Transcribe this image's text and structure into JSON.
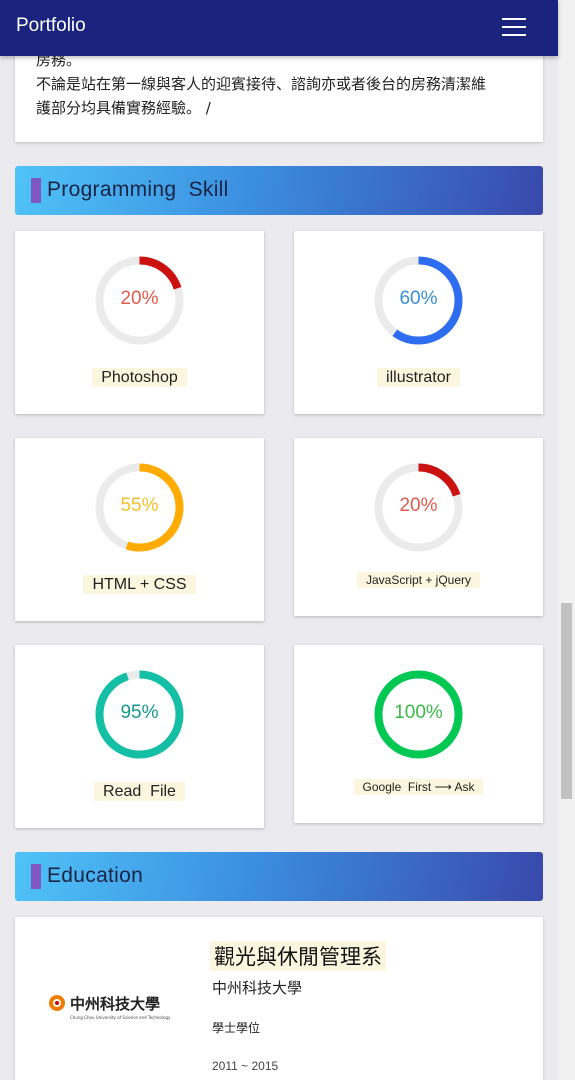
{
  "nav": {
    "brand": "Portfolio",
    "menu_icon": "hamburger-menu-icon",
    "background": "#1a237e"
  },
  "about": {
    "lines": [
      "房務。",
      "不論是站在第一線與客人的迎賓接待、諮詢亦或者後台的房務清潔維",
      "護部分均具備實務經驗。 /"
    ]
  },
  "sections": {
    "programming": "Programming  Skill",
    "education": "Education"
  },
  "skills": [
    {
      "label": "Photoshop",
      "percent": 20,
      "percent_text": "20%",
      "color": "#cc1111",
      "text_color": "#e05a4e"
    },
    {
      "label": "illustrator",
      "percent": 60,
      "percent_text": "60%",
      "color": "#2f6df0",
      "text_color": "#3a8fd8"
    },
    {
      "label": "HTML + CSS",
      "percent": 55,
      "percent_text": "55%",
      "color": "#ffab00",
      "text_color": "#f4c02a"
    },
    {
      "label": "JavaScript + jQuery",
      "percent": 20,
      "percent_text": "20%",
      "color": "#cc1111",
      "text_color": "#e05a4e"
    },
    {
      "label": "Read  File",
      "percent": 95,
      "percent_text": "95%",
      "color": "#14bfa6",
      "text_color": "#159a8a"
    },
    {
      "label": "Google  First ⟶ Ask",
      "percent": 100,
      "percent_text": "100%",
      "color": "#00c853",
      "text_color": "#3cb84a"
    }
  ],
  "education": {
    "department": "觀光與休閒管理系",
    "school": "中州科技大學",
    "degree": "學士學位",
    "years": "2011 ~ 2015",
    "logo_text": "中州科技大學",
    "logo_subtext": "Chung Chou University of Science and Technology"
  }
}
